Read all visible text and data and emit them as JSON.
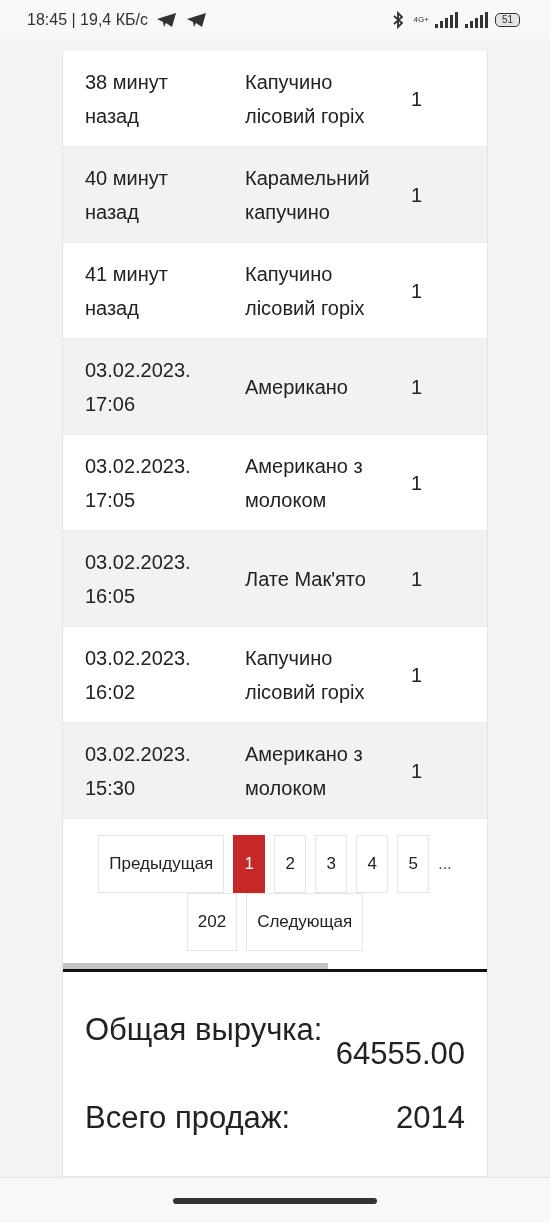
{
  "status_bar": {
    "time": "18:45 | 19,4 КБ/с",
    "network": "4G+",
    "battery": "51"
  },
  "sales": [
    {
      "time": "38 минут назад",
      "product": "Капучино лісовий горіх",
      "quantity": "1"
    },
    {
      "time": "40 минут назад",
      "product": "Карамельний капучино",
      "quantity": "1"
    },
    {
      "time": "41 минут назад",
      "product": "Капучино лісовий горіх",
      "quantity": "1"
    },
    {
      "time": "03.02.2023. 17:06",
      "product": "Американо",
      "quantity": "1"
    },
    {
      "time": "03.02.2023. 17:05",
      "product": "Американо з молоком",
      "quantity": "1"
    },
    {
      "time": "03.02.2023. 16:05",
      "product": "Лате Мак'ято",
      "quantity": "1"
    },
    {
      "time": "03.02.2023. 16:02",
      "product": "Капучино лісовий горіх",
      "quantity": "1"
    },
    {
      "time": "03.02.2023. 15:30",
      "product": "Американо з молоком",
      "quantity": "1"
    }
  ],
  "pagination": [
    {
      "kind": "button",
      "label": "Предыдущая",
      "selected": false
    },
    {
      "kind": "button",
      "label": "1",
      "selected": true
    },
    {
      "kind": "button",
      "label": "2",
      "selected": false
    },
    {
      "kind": "button",
      "label": "3",
      "selected": false
    },
    {
      "kind": "button",
      "label": "4",
      "selected": false
    },
    {
      "kind": "button",
      "label": "5",
      "selected": false
    },
    {
      "kind": "ellipsis",
      "label": "..."
    },
    {
      "kind": "button",
      "label": "202",
      "selected": false
    },
    {
      "kind": "button",
      "label": "Следующая",
      "selected": false
    }
  ],
  "summary": {
    "revenue_label": "Общая выручка:",
    "revenue": "64555.00",
    "sales_label": "Всего продаж:",
    "sales_count": "2014"
  }
}
